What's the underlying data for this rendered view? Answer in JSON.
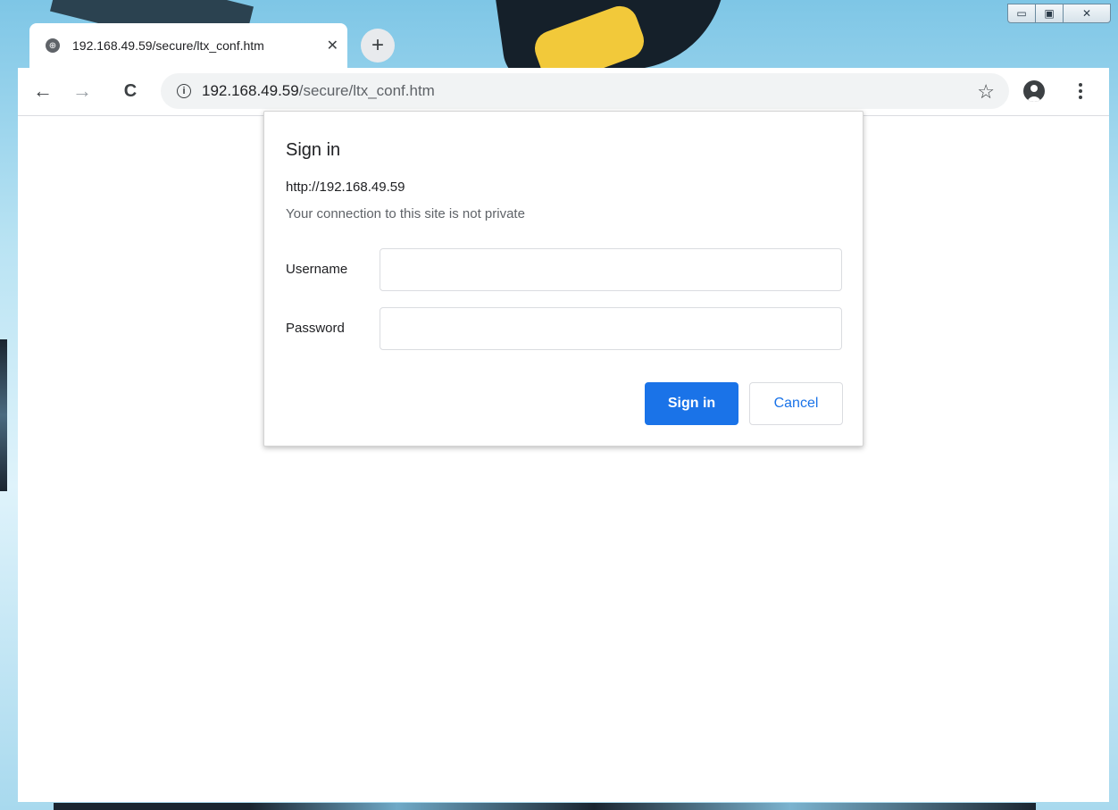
{
  "window": {
    "controls": {
      "minimize": "▭",
      "maximize": "▣",
      "close": "✕"
    }
  },
  "tab": {
    "title": "192.168.49.59/secure/ltx_conf.htm",
    "close_label": "✕",
    "new_tab_label": "+"
  },
  "toolbar": {
    "back_label": "←",
    "forward_label": "→",
    "reload_label": "C",
    "info_label": "i",
    "url_host": "192.168.49.59",
    "url_path": "/secure/ltx_conf.htm",
    "star_label": "☆"
  },
  "dialog": {
    "title": "Sign in",
    "origin": "http://192.168.49.59",
    "warning": "Your connection to this site is not private",
    "username_label": "Username",
    "username_value": "",
    "password_label": "Password",
    "password_value": "",
    "signin_button": "Sign in",
    "cancel_button": "Cancel"
  },
  "colors": {
    "accent": "#1a73e8",
    "text": "#202124",
    "muted": "#5f6368"
  }
}
